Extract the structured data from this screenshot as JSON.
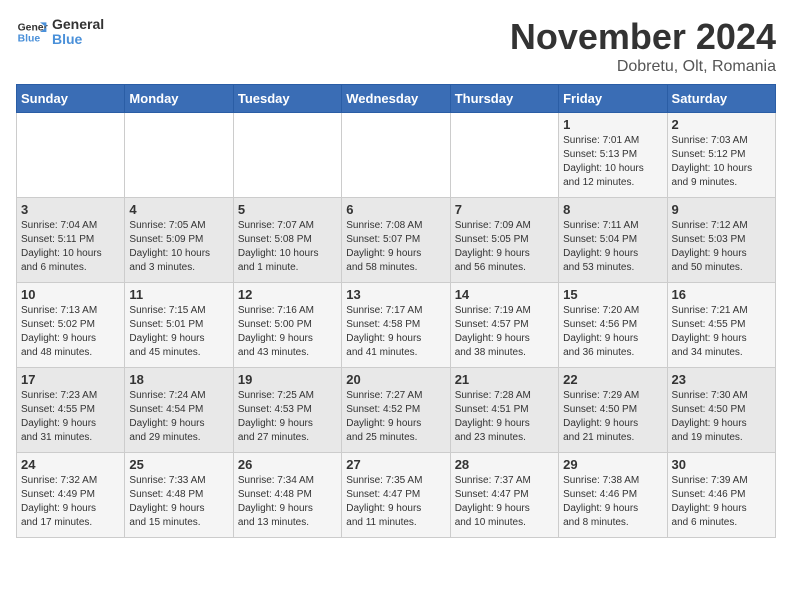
{
  "logo": {
    "line1": "General",
    "line2": "Blue"
  },
  "title": "November 2024",
  "subtitle": "Dobretu, Olt, Romania",
  "weekdays": [
    "Sunday",
    "Monday",
    "Tuesday",
    "Wednesday",
    "Thursday",
    "Friday",
    "Saturday"
  ],
  "weeks": [
    [
      {
        "day": "",
        "info": ""
      },
      {
        "day": "",
        "info": ""
      },
      {
        "day": "",
        "info": ""
      },
      {
        "day": "",
        "info": ""
      },
      {
        "day": "",
        "info": ""
      },
      {
        "day": "1",
        "info": "Sunrise: 7:01 AM\nSunset: 5:13 PM\nDaylight: 10 hours\nand 12 minutes."
      },
      {
        "day": "2",
        "info": "Sunrise: 7:03 AM\nSunset: 5:12 PM\nDaylight: 10 hours\nand 9 minutes."
      }
    ],
    [
      {
        "day": "3",
        "info": "Sunrise: 7:04 AM\nSunset: 5:11 PM\nDaylight: 10 hours\nand 6 minutes."
      },
      {
        "day": "4",
        "info": "Sunrise: 7:05 AM\nSunset: 5:09 PM\nDaylight: 10 hours\nand 3 minutes."
      },
      {
        "day": "5",
        "info": "Sunrise: 7:07 AM\nSunset: 5:08 PM\nDaylight: 10 hours\nand 1 minute."
      },
      {
        "day": "6",
        "info": "Sunrise: 7:08 AM\nSunset: 5:07 PM\nDaylight: 9 hours\nand 58 minutes."
      },
      {
        "day": "7",
        "info": "Sunrise: 7:09 AM\nSunset: 5:05 PM\nDaylight: 9 hours\nand 56 minutes."
      },
      {
        "day": "8",
        "info": "Sunrise: 7:11 AM\nSunset: 5:04 PM\nDaylight: 9 hours\nand 53 minutes."
      },
      {
        "day": "9",
        "info": "Sunrise: 7:12 AM\nSunset: 5:03 PM\nDaylight: 9 hours\nand 50 minutes."
      }
    ],
    [
      {
        "day": "10",
        "info": "Sunrise: 7:13 AM\nSunset: 5:02 PM\nDaylight: 9 hours\nand 48 minutes."
      },
      {
        "day": "11",
        "info": "Sunrise: 7:15 AM\nSunset: 5:01 PM\nDaylight: 9 hours\nand 45 minutes."
      },
      {
        "day": "12",
        "info": "Sunrise: 7:16 AM\nSunset: 5:00 PM\nDaylight: 9 hours\nand 43 minutes."
      },
      {
        "day": "13",
        "info": "Sunrise: 7:17 AM\nSunset: 4:58 PM\nDaylight: 9 hours\nand 41 minutes."
      },
      {
        "day": "14",
        "info": "Sunrise: 7:19 AM\nSunset: 4:57 PM\nDaylight: 9 hours\nand 38 minutes."
      },
      {
        "day": "15",
        "info": "Sunrise: 7:20 AM\nSunset: 4:56 PM\nDaylight: 9 hours\nand 36 minutes."
      },
      {
        "day": "16",
        "info": "Sunrise: 7:21 AM\nSunset: 4:55 PM\nDaylight: 9 hours\nand 34 minutes."
      }
    ],
    [
      {
        "day": "17",
        "info": "Sunrise: 7:23 AM\nSunset: 4:55 PM\nDaylight: 9 hours\nand 31 minutes."
      },
      {
        "day": "18",
        "info": "Sunrise: 7:24 AM\nSunset: 4:54 PM\nDaylight: 9 hours\nand 29 minutes."
      },
      {
        "day": "19",
        "info": "Sunrise: 7:25 AM\nSunset: 4:53 PM\nDaylight: 9 hours\nand 27 minutes."
      },
      {
        "day": "20",
        "info": "Sunrise: 7:27 AM\nSunset: 4:52 PM\nDaylight: 9 hours\nand 25 minutes."
      },
      {
        "day": "21",
        "info": "Sunrise: 7:28 AM\nSunset: 4:51 PM\nDaylight: 9 hours\nand 23 minutes."
      },
      {
        "day": "22",
        "info": "Sunrise: 7:29 AM\nSunset: 4:50 PM\nDaylight: 9 hours\nand 21 minutes."
      },
      {
        "day": "23",
        "info": "Sunrise: 7:30 AM\nSunset: 4:50 PM\nDaylight: 9 hours\nand 19 minutes."
      }
    ],
    [
      {
        "day": "24",
        "info": "Sunrise: 7:32 AM\nSunset: 4:49 PM\nDaylight: 9 hours\nand 17 minutes."
      },
      {
        "day": "25",
        "info": "Sunrise: 7:33 AM\nSunset: 4:48 PM\nDaylight: 9 hours\nand 15 minutes."
      },
      {
        "day": "26",
        "info": "Sunrise: 7:34 AM\nSunset: 4:48 PM\nDaylight: 9 hours\nand 13 minutes."
      },
      {
        "day": "27",
        "info": "Sunrise: 7:35 AM\nSunset: 4:47 PM\nDaylight: 9 hours\nand 11 minutes."
      },
      {
        "day": "28",
        "info": "Sunrise: 7:37 AM\nSunset: 4:47 PM\nDaylight: 9 hours\nand 10 minutes."
      },
      {
        "day": "29",
        "info": "Sunrise: 7:38 AM\nSunset: 4:46 PM\nDaylight: 9 hours\nand 8 minutes."
      },
      {
        "day": "30",
        "info": "Sunrise: 7:39 AM\nSunset: 4:46 PM\nDaylight: 9 hours\nand 6 minutes."
      }
    ]
  ]
}
